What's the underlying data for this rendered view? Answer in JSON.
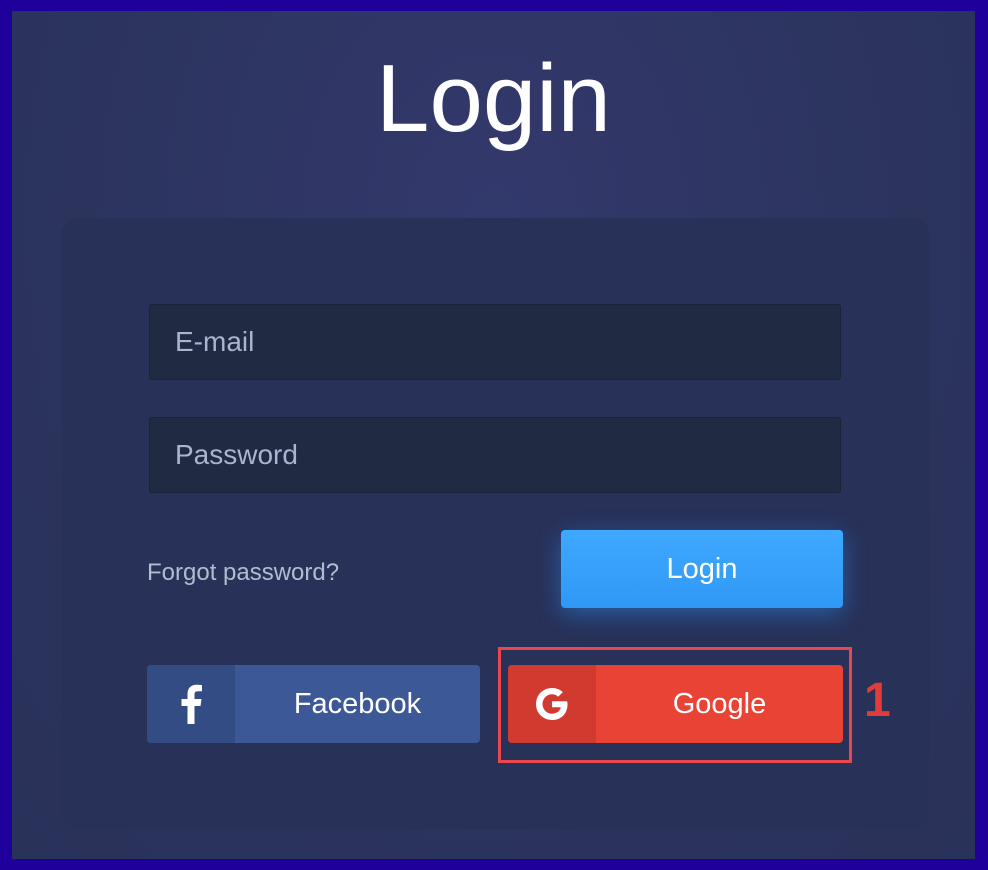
{
  "page": {
    "title": "Login"
  },
  "form": {
    "email_placeholder": "E-mail",
    "email_value": "",
    "password_placeholder": "Password",
    "password_value": "",
    "forgot_label": "Forgot password?",
    "login_label": "Login"
  },
  "social": {
    "facebook_label": "Facebook",
    "google_label": "Google"
  },
  "annotation": {
    "marker_label": "1"
  },
  "colors": {
    "outer_border": "#1f009a",
    "background": "#2c345f",
    "card": "#283158",
    "input_bg": "#212a43",
    "login_button": "#3aa3ff",
    "facebook": "#3c5896",
    "google": "#e84334",
    "highlight": "#e8484c"
  },
  "icons": {
    "facebook": "facebook-icon",
    "google": "google-icon"
  }
}
